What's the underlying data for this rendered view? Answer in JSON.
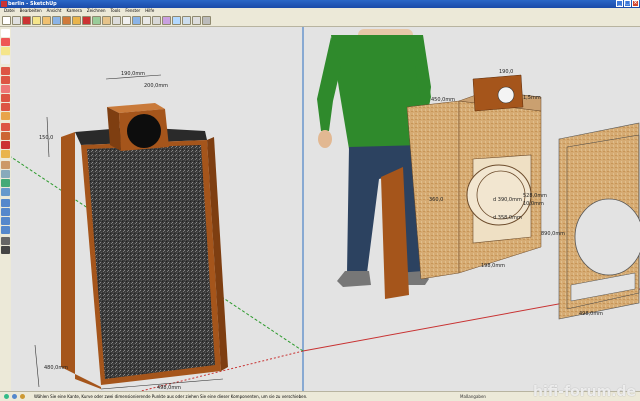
{
  "window": {
    "title": "berlin - SketchUp"
  },
  "menu": [
    "Datei",
    "Bearbeiten",
    "Ansicht",
    "Kamera",
    "Zeichnen",
    "Tools",
    "Fenster",
    "Hilfe"
  ],
  "dimensions": {
    "top_box_width": "190,0mm",
    "top_box_depth": "200,0mm",
    "cabinet_height_top": "150,0",
    "cabinet_depth": "480,0mm",
    "cabinet_width": "498,0mm",
    "model2_top_box_width": "190,0",
    "model2_box_height": "450,0mm",
    "model2_small": "1,5mm",
    "model2_side": "360,0",
    "model2_circle_large": "d 390,0mm",
    "model2_circle_small": "d 358,0mm",
    "model2_side_height": "528,0mm",
    "model2_depth": "10,0mm",
    "model2_bottom": "198,0mm",
    "panel_height": "890,0mm",
    "panel_width": "498,0mm"
  },
  "status": {
    "hint": "Wählen Sie eine Kante, Kurve oder zwei dimensionierende Punkte aus oder ziehen Sie eine dieser Komponenten, um sie zu verschieben.",
    "measure_label": "Maßangaben"
  },
  "watermark": "hifi-forum.de",
  "colors": {
    "titlebar": "#1a4aa8",
    "wood": "#a5551b",
    "plywood": "#d9b07b",
    "grille": "#3b3b3b",
    "shirt": "#2f8a2c",
    "jeans": "#2c4260",
    "axis_red": "#c83232",
    "axis_green": "#2e9b2e"
  }
}
